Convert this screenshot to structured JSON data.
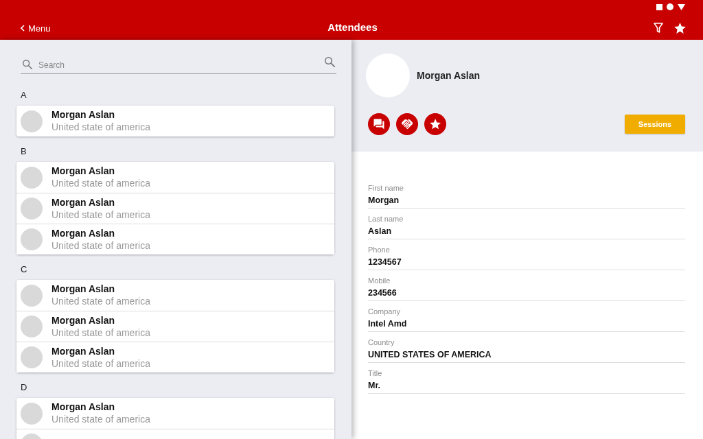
{
  "app_bar": {
    "back_label": "Menu",
    "title": "Attendees"
  },
  "search": {
    "placeholder": "Search"
  },
  "attendee_sections": [
    {
      "letter": "A",
      "attendees": [
        {
          "name": "Morgan Aslan",
          "country": "United state of america"
        }
      ]
    },
    {
      "letter": "B",
      "attendees": [
        {
          "name": "Morgan Aslan",
          "country": "United state of america"
        },
        {
          "name": "Morgan Aslan",
          "country": "United state of america"
        },
        {
          "name": "Morgan Aslan",
          "country": "United state of america"
        }
      ]
    },
    {
      "letter": "C",
      "attendees": [
        {
          "name": "Morgan Aslan",
          "country": "United state of america"
        },
        {
          "name": "Morgan Aslan",
          "country": "United state of america"
        },
        {
          "name": "Morgan Aslan",
          "country": "United state of america"
        }
      ]
    },
    {
      "letter": "D",
      "attendees": [
        {
          "name": "Morgan Aslan",
          "country": "United state of america"
        }
      ],
      "more_below": true
    }
  ],
  "profile": {
    "name": "Morgan Aslan",
    "sessions_button": "Sessions",
    "fields": [
      {
        "label": "First name",
        "value": "Morgan"
      },
      {
        "label": "Last name",
        "value": "Aslan"
      },
      {
        "label": "Phone",
        "value": "1234567"
      },
      {
        "label": "Mobile",
        "value": "234566"
      },
      {
        "label": "Company",
        "value": "Intel Amd"
      },
      {
        "label": "Country",
        "value": "UNITED STATES OF AMERICA"
      },
      {
        "label": "Title",
        "value": "Mr."
      }
    ]
  }
}
